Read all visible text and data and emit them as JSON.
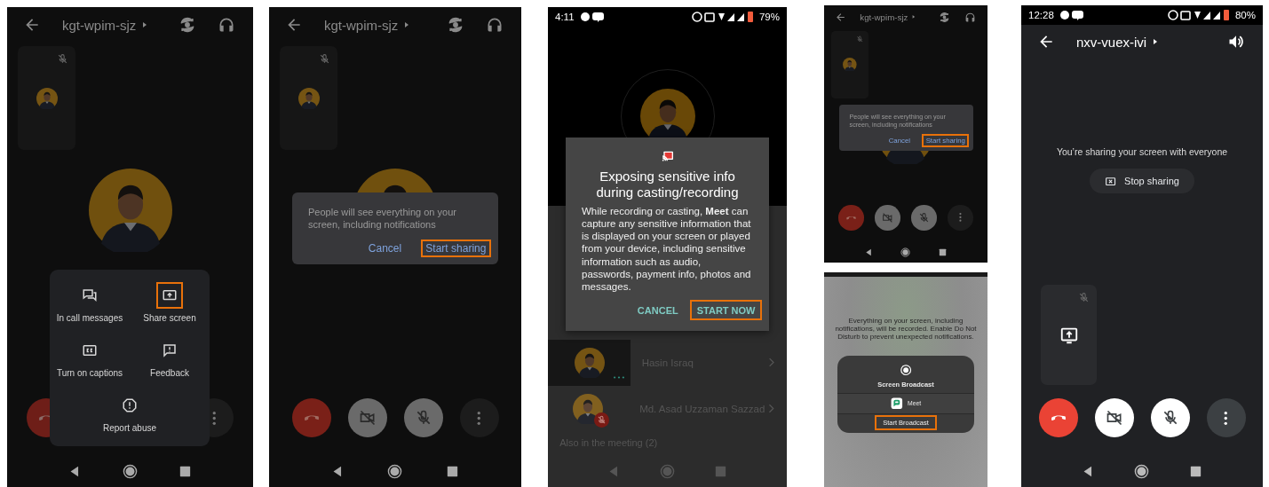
{
  "columns": [
    {
      "screens": [
        {
          "kind": "call_menu",
          "meeting_code": "kgt-wpim-sjz",
          "menu_items": [
            {
              "kind": "messages",
              "label": "In call messages",
              "highlighted": false
            },
            {
              "kind": "share",
              "label": "Share screen",
              "highlighted": true
            },
            {
              "kind": "captions",
              "label": "Turn on captions",
              "highlighted": false
            },
            {
              "kind": "feedback",
              "label": "Feedback",
              "highlighted": false
            },
            {
              "kind": "report",
              "label": "Report abuse",
              "highlighted": false
            }
          ]
        }
      ]
    },
    {
      "screens": [
        {
          "kind": "share_prompt",
          "meeting_code": "kgt-wpim-sjz",
          "message": "People will see everything on your screen, including notifications",
          "actions": [
            {
              "label": "Cancel",
              "highlighted": false
            },
            {
              "label": "Start sharing",
              "highlighted": true
            }
          ]
        }
      ]
    },
    {
      "screens": [
        {
          "kind": "cast_dialog",
          "status_time": "4:11",
          "battery": "79%",
          "participants": [
            "Hasin Israq",
            "Md. Asad Uzzaman Sazzad"
          ],
          "section_label": "Also in the meeting (2)",
          "title": "Exposing sensitive info during casting/recording",
          "message": "While recording or casting, **Meet** can capture any sensitive information that is displayed on your screen or played from your device, including sensitive information such as audio, passwords, payment info, photos and messages.",
          "actions": [
            {
              "label": "CANCEL",
              "highlighted": false
            },
            {
              "label": "START NOW",
              "highlighted": true
            }
          ]
        }
      ]
    },
    {
      "screens": [
        {
          "kind": "share_prompt",
          "meeting_code": "kgt-wpim-sjz",
          "message": "People will see everything on your screen, including notifications",
          "actions": [
            {
              "label": "Cancel",
              "highlighted": false
            },
            {
              "label": "Start sharing",
              "highlighted": true
            }
          ]
        },
        {
          "kind": "broadcast_sheet",
          "notice": "Everything on your screen, including notifications, will be recorded. Enable Do Not Disturb to prevent unexpected notifications.",
          "title": "Screen Broadcast",
          "app_name": "Meet",
          "actions": [
            {
              "label": "Start Broadcast",
              "highlighted": true
            }
          ]
        }
      ]
    },
    {
      "screens": [
        {
          "kind": "sharing",
          "status_time": "12:28",
          "battery": "80%",
          "meeting_code": "nxv-vuex-ivi",
          "message": "You’re sharing your screen with everyone",
          "stop_label": "Stop sharing"
        }
      ]
    }
  ]
}
